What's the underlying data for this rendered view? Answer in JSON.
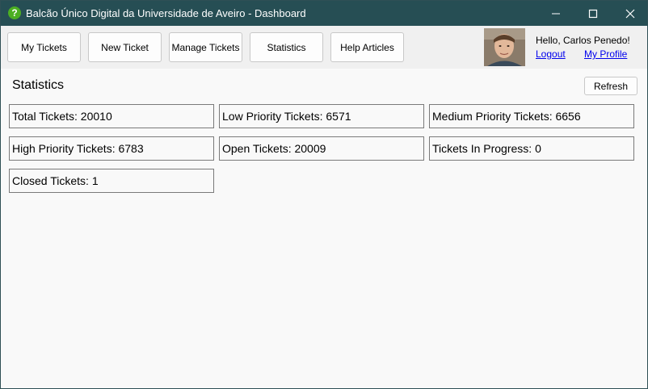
{
  "window": {
    "title": "Balcão Único Digital da Universidade de Aveiro - Dashboard",
    "app_icon_glyph": "?",
    "app_icon_color": "#4caf22",
    "titlebar_color": "#264e54"
  },
  "toolbar": {
    "buttons": [
      {
        "label": "My Tickets"
      },
      {
        "label": "New Ticket"
      },
      {
        "label": "Manage Tickets"
      },
      {
        "label": "Statistics"
      },
      {
        "label": "Help Articles"
      }
    ]
  },
  "user": {
    "greeting": "Hello, Carlos Penedo!",
    "logout_label": "Logout",
    "profile_label": "My Profile"
  },
  "main": {
    "title": "Statistics",
    "refresh_label": "Refresh",
    "stats": [
      {
        "label": "Total Tickets: 20010"
      },
      {
        "label": "Low Priority Tickets: 6571"
      },
      {
        "label": "Medium Priority Tickets: 6656"
      },
      {
        "label": "High Priority Tickets: 6783"
      },
      {
        "label": "Open Tickets: 20009"
      },
      {
        "label": "Tickets In Progress: 0"
      },
      {
        "label": "Closed Tickets: 1"
      }
    ]
  },
  "icons": {
    "app": "help-question-icon",
    "minimize": "minimize-icon",
    "maximize": "maximize-icon",
    "close": "close-icon",
    "avatar": "user-avatar"
  }
}
